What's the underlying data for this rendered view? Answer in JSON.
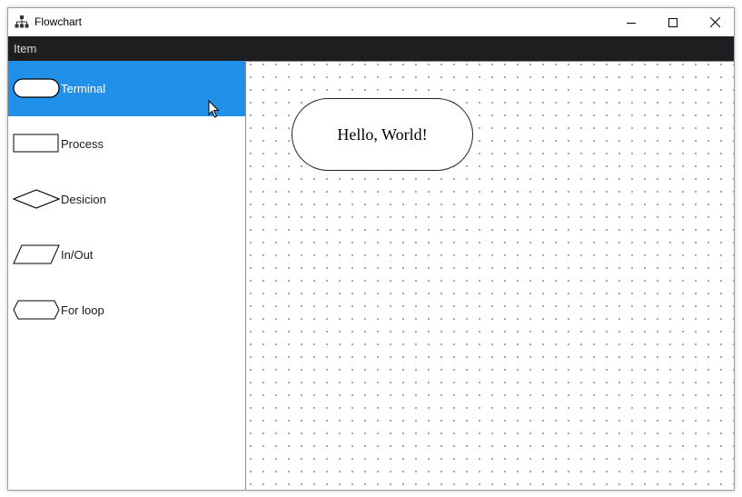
{
  "window": {
    "title": "Flowchart",
    "icon": "sitemap-icon",
    "controls": [
      "minimize-icon",
      "maximize-icon",
      "close-icon"
    ]
  },
  "menu": {
    "items": [
      "Item"
    ]
  },
  "palette": {
    "items": [
      {
        "label": "Terminal",
        "shape": "terminal",
        "selected": true
      },
      {
        "label": "Process",
        "shape": "process",
        "selected": false
      },
      {
        "label": "Desicion",
        "shape": "decision",
        "selected": false
      },
      {
        "label": "In/Out",
        "shape": "inout",
        "selected": false
      },
      {
        "label": "For loop",
        "shape": "forloop",
        "selected": false
      }
    ]
  },
  "canvas": {
    "nodes": [
      {
        "shape": "terminal",
        "text": "Hello, World!"
      }
    ]
  },
  "colors": {
    "selection": "#2090e8",
    "menubar": "#1d1e20"
  }
}
